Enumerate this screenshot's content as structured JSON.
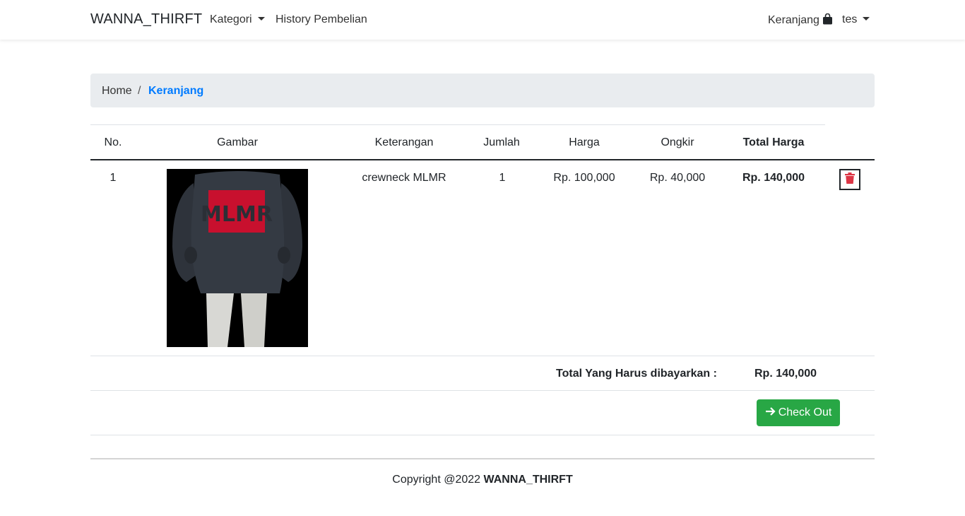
{
  "navbar": {
    "brand": "WANNA_THIRFT",
    "kategori": "Kategori",
    "history": "History Pembelian",
    "cart": "Keranjang",
    "user": "tes"
  },
  "breadcrumb": {
    "home": "Home",
    "separator": "/",
    "active": "Keranjang"
  },
  "table": {
    "headers": [
      "No.",
      "Gambar",
      "Keterangan",
      "Jumlah",
      "Harga",
      "Ongkir",
      "Total Harga"
    ],
    "rows": [
      {
        "no": "1",
        "keterangan": "crewneck MLMR",
        "jumlah": "1",
        "harga": "Rp. 100,000",
        "ongkir": "Rp. 40,000",
        "total": "Rp. 140,000"
      }
    ]
  },
  "summary": {
    "label": "Total Yang Harus dibayarkan :",
    "value": "Rp. 140,000"
  },
  "actions": {
    "checkout": "Check Out"
  },
  "footer": {
    "prefix": "Copyright @2022",
    "brand": "WANNA_THIRFT"
  },
  "icons": {
    "cart": "shopping-bag-icon",
    "delete": "trash-icon",
    "checkout": "arrow-right-icon"
  },
  "colors": {
    "primary": "#007bff",
    "success": "#28a745",
    "danger": "#dc3545",
    "breadcrumb_bg": "#e9ecef"
  }
}
